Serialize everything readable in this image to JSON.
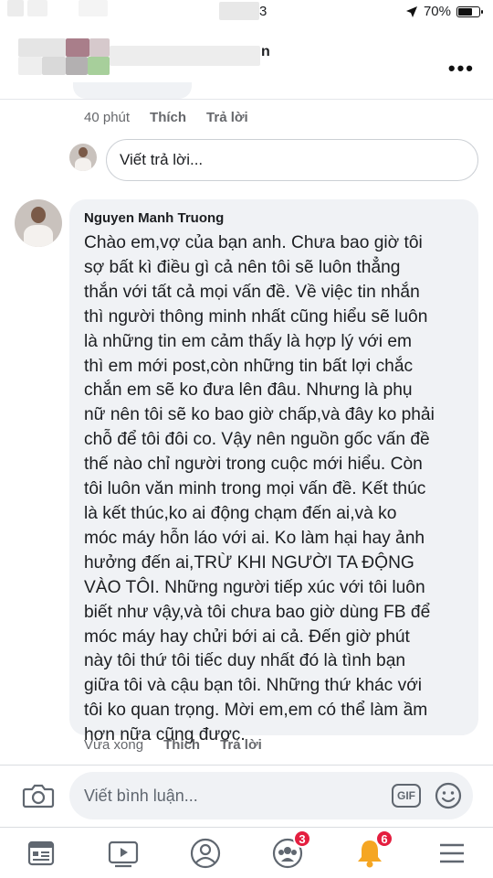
{
  "status_bar": {
    "time_partial": "3",
    "battery_percent_label": "70%",
    "battery_level": 0.7
  },
  "header": {
    "title_partial": "n",
    "more_icon": "more-dots-icon"
  },
  "previous_comment": {
    "time": "40 phút",
    "like_label": "Thích",
    "reply_label": "Trả lời"
  },
  "reply_box": {
    "placeholder": "Viết trả lời..."
  },
  "comment": {
    "author": "Nguyen Manh Truong",
    "lines": [
      "Chào em,vợ của bạn anh. Chưa bao giờ tôi",
      "sợ bất kì điều gì cả nên tôi sẽ luôn thẳng",
      "thắn với tất cả mọi vấn đề. Về việc tin nhắn",
      "thì người thông minh nhất cũng hiểu sẽ luôn",
      "là những tin em cảm thấy là hợp lý với em",
      "thì em mới post,còn những tin bất lợi chắc",
      "chắn em sẽ ko đưa lên đâu. Nhưng là phụ",
      "nữ nên tôi sẽ ko bao giờ chấp,và đây ko phải",
      "chỗ để tôi đôi co. Vậy nên nguồn gốc vấn đề",
      "thế nào chỉ người trong cuộc mới hiểu. Còn",
      "tôi luôn văn minh trong mọi vấn đề. Kết thúc",
      "là kết thúc,ko ai động chạm đến ai,và ko",
      "móc máy hỗn láo với ai. Ko làm hại hay ảnh",
      "hưởng đến ai,TRỪ KHI NGƯỜI TA ĐỘNG",
      "VÀO TÔI. Những người tiếp xúc với tôi luôn",
      "biết như vậy,và tôi chưa bao giờ dùng FB để",
      "móc máy hay chửi bới ai cả. Đến giờ phút",
      "này tôi thứ tôi tiếc duy nhất đó là tình bạn",
      "giữa tôi và cậu bạn tôi. Những thứ khác với",
      "tôi ko quan trọng. Mời em,em có thể làm ầm",
      "hơn nữa cũng được."
    ],
    "time": "Vừa xong",
    "like_label": "Thích",
    "reply_label": "Trả lời"
  },
  "compose": {
    "placeholder": "Viết bình luận...",
    "gif_label": "GIF",
    "camera_icon": "camera-icon",
    "emoji_icon": "emoji-icon"
  },
  "bottom_nav": {
    "items": [
      {
        "icon": "news-feed-icon"
      },
      {
        "icon": "watch-video-icon"
      },
      {
        "icon": "profile-icon"
      },
      {
        "icon": "groups-icon",
        "badge": "3"
      },
      {
        "icon": "notifications-bell-icon",
        "badge": "6"
      },
      {
        "icon": "menu-icon"
      }
    ]
  },
  "colors": {
    "accent_blue": "#1877f2",
    "badge_red": "#e41e3f",
    "bell_orange": "#f5a623",
    "bubble_gray": "#f0f2f5",
    "secondary_text": "#65676b"
  }
}
